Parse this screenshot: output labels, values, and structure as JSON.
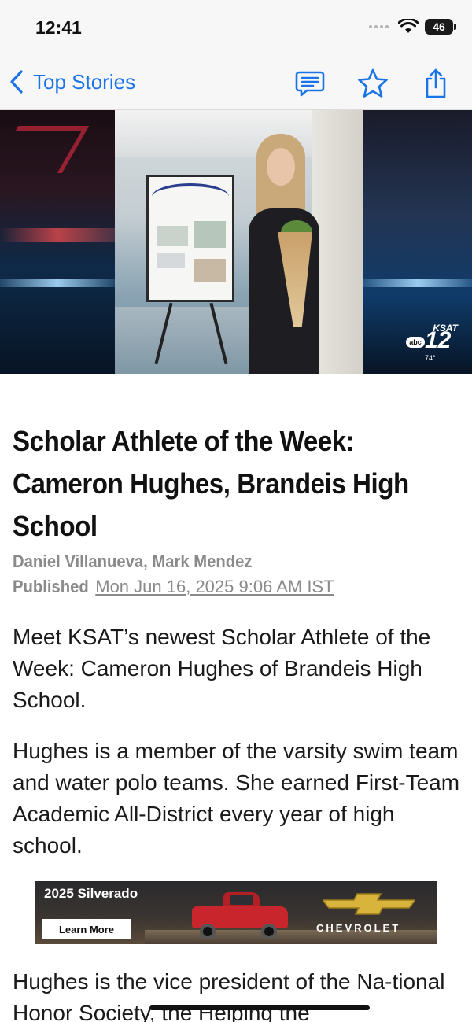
{
  "status_bar": {
    "time": "12:41",
    "battery": "46"
  },
  "nav": {
    "back_label": "Top Stories",
    "icons": [
      "comment-icon",
      "star-icon",
      "share-icon"
    ],
    "accent_color": "#1a73e8"
  },
  "hero": {
    "station_brand": "KSAT",
    "station_number": "12",
    "network": "abc",
    "temperature": "74°"
  },
  "article": {
    "headline": "Scholar Athlete of the Week: Cameron Hughes, Brandeis High School",
    "authors": "Daniel Villanueva, Mark Mendez",
    "published_label": "Published",
    "published_date": "Mon Jun 16, 2025 9:06 AM IST",
    "paragraphs": [
      "Meet KSAT’s newest Scholar Athlete of the Week: Cameron Hughes of Brandeis High School.",
      "Hughes is a member of the varsity swim team and water polo teams. She earned First-Team Academic All-District every year of high school.",
      "Hughes is the vice president of the Na-tional Honor Society, the Helping the"
    ]
  },
  "ad": {
    "title": "2025 Silverado",
    "cta": "Learn More",
    "brand": "CHEVROLET"
  }
}
